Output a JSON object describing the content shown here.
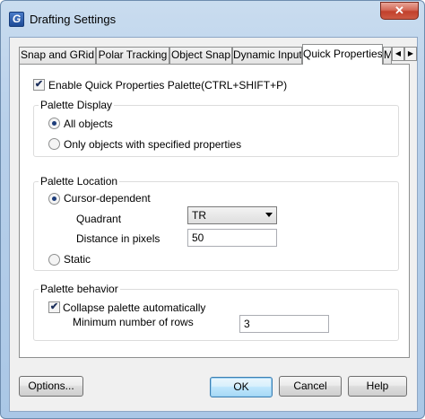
{
  "window": {
    "title": "Drafting Settings",
    "app_icon_letter": "G",
    "close_glyph": "✕"
  },
  "tabs": [
    {
      "label": "Snap and GRid"
    },
    {
      "label": "Polar Tracking"
    },
    {
      "label": "Object Snap"
    },
    {
      "label": "Dynamic Input"
    },
    {
      "label": "Quick Properties",
      "active": true
    },
    {
      "label": "M"
    }
  ],
  "tab_scroll": {
    "left": "◀",
    "right": "▶"
  },
  "enable_qp": {
    "label": "Enable Quick Properties Palette(CTRL+SHIFT+P)",
    "checked": true,
    "check_glyph": "✔"
  },
  "palette_display": {
    "title": "Palette Display",
    "options": [
      {
        "label": "All objects",
        "checked": true
      },
      {
        "label": "Only objects with specified properties",
        "checked": false
      }
    ]
  },
  "palette_location": {
    "title": "Palette Location",
    "cursor_dependent": {
      "label": "Cursor-dependent",
      "checked": true
    },
    "quadrant": {
      "label": "Quadrant",
      "value": "TR"
    },
    "distance": {
      "label": "Distance in pixels",
      "value": "50"
    },
    "static": {
      "label": "Static",
      "checked": false
    }
  },
  "palette_behavior": {
    "title": "Palette behavior",
    "collapse": {
      "label": "Collapse palette automatically",
      "checked": true,
      "check_glyph": "✔"
    },
    "min_rows": {
      "label": "Minimum number of rows",
      "value": "3"
    }
  },
  "buttons": {
    "options": "Options...",
    "ok": "OK",
    "cancel": "Cancel",
    "help": "Help"
  }
}
